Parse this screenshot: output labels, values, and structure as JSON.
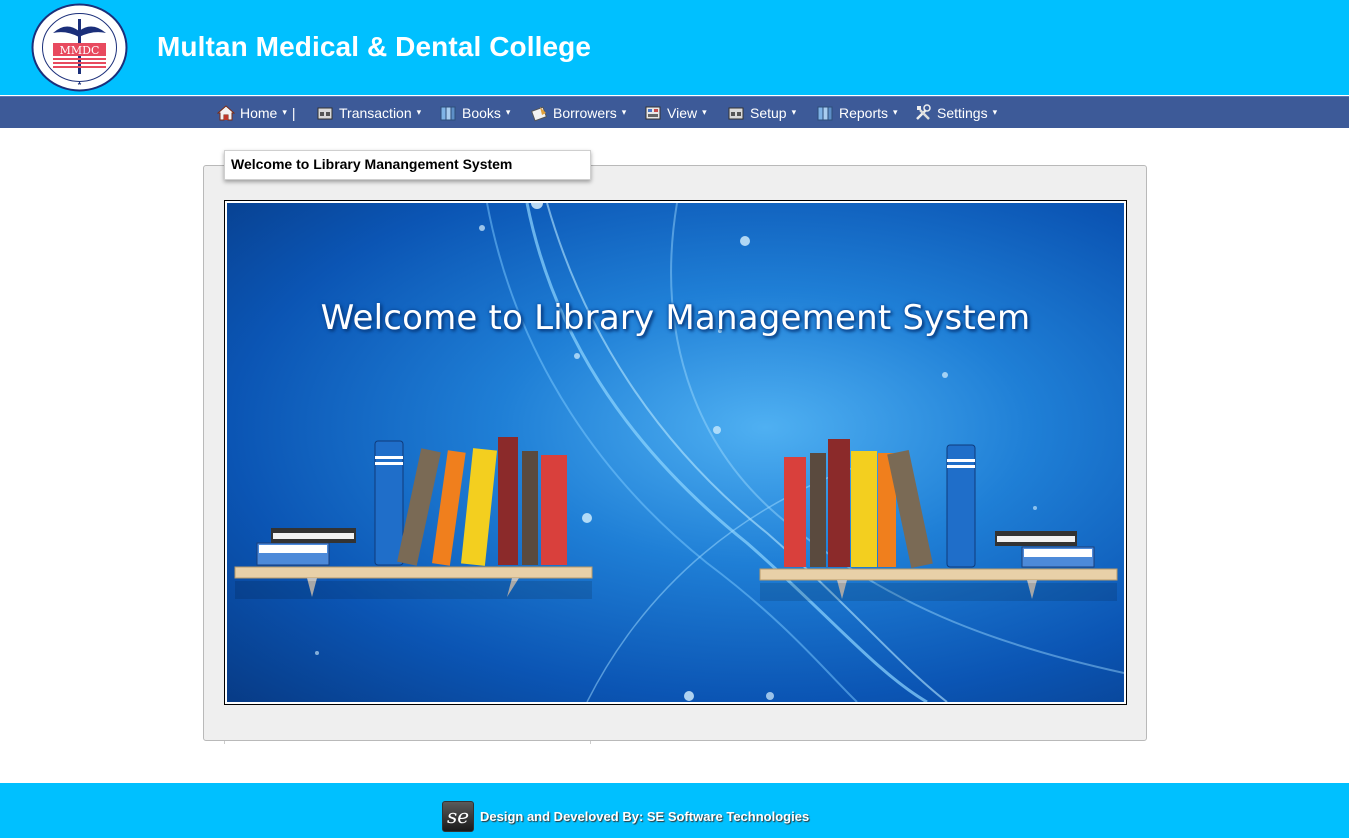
{
  "header": {
    "logo_text": "MMDC",
    "logo_ring_text": "MULTAN MEDICAL & DENTAL COLLEGE",
    "title": "Multan Medical & Dental College"
  },
  "nav": {
    "items": [
      {
        "label": "Home",
        "icon": "home-icon",
        "suffix": "|"
      },
      {
        "label": "Transaction",
        "icon": "transaction-icon"
      },
      {
        "label": "Books",
        "icon": "books-icon"
      },
      {
        "label": "Borrowers",
        "icon": "borrowers-icon"
      },
      {
        "label": "View",
        "icon": "view-icon"
      },
      {
        "label": "Setup",
        "icon": "setup-icon"
      },
      {
        "label": "Reports",
        "icon": "reports-icon"
      },
      {
        "label": "Settings",
        "icon": "settings-icon"
      }
    ]
  },
  "panel": {
    "legend": "Welcome to Library Manangement System",
    "banner_title": "Welcome to Library Management System"
  },
  "footer": {
    "logo_text": "se",
    "credit": "Design and Develoved By: SE Software Technologies"
  },
  "colors": {
    "header_bg": "#00c0ff",
    "nav_bg": "#3d5a98",
    "panel_bg": "#efefef"
  }
}
